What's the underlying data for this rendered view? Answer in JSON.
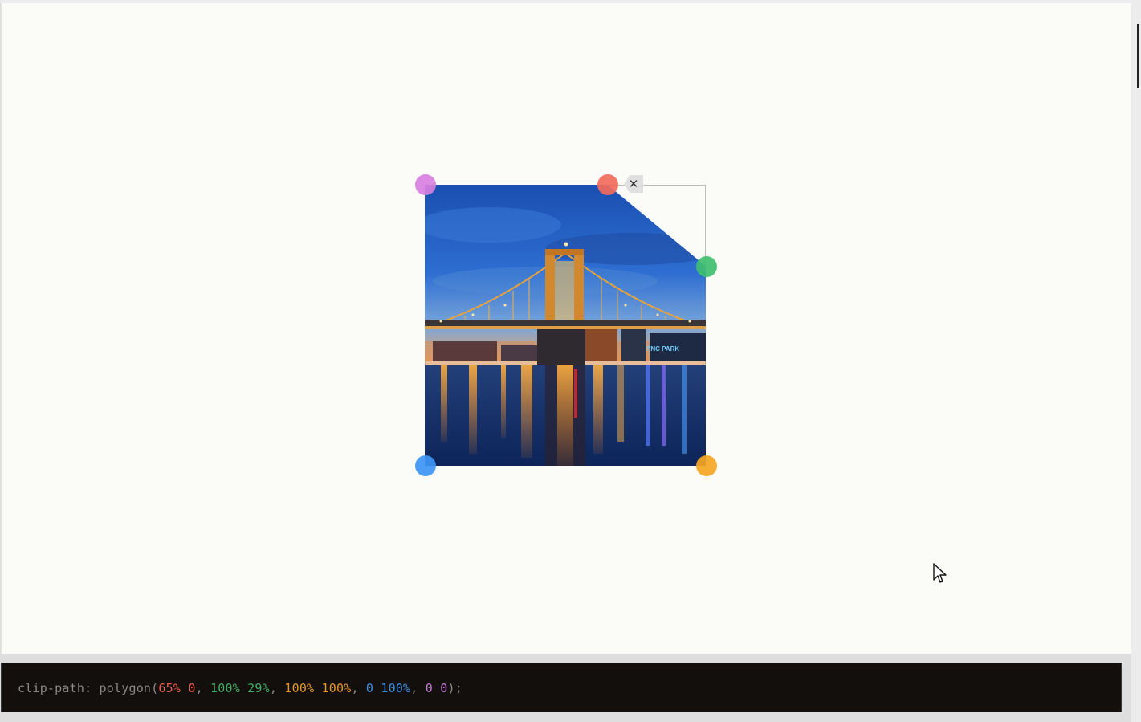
{
  "editor": {
    "remove_point_label": "✕",
    "handle_colors": {
      "top_left": "#d87fe0",
      "top_cut": "#f26b5b",
      "right_cut": "#3fbf6f",
      "bottom_right": "#f5a623",
      "bottom_left": "#3d95f5"
    },
    "image": {
      "subject": "illuminated suspension bridge over river at dusk",
      "sign_text": "PNC PARK"
    }
  },
  "code": {
    "property": "clip-path:",
    "function_open": "polygon(",
    "p1": "65% 0",
    "p2": "100% 29%",
    "p3": "100% 100%",
    "p4": "0 100%",
    "p5": "0 0",
    "function_close": ");",
    "colors": {
      "property": "#8a8a8a",
      "p1": "#e85d4a",
      "p2": "#3fae63",
      "p3": "#e8962a",
      "p4": "#3d8fe6",
      "p5": "#c77ad6"
    }
  },
  "cursor": {
    "icon": "mouse-pointer-icon"
  }
}
